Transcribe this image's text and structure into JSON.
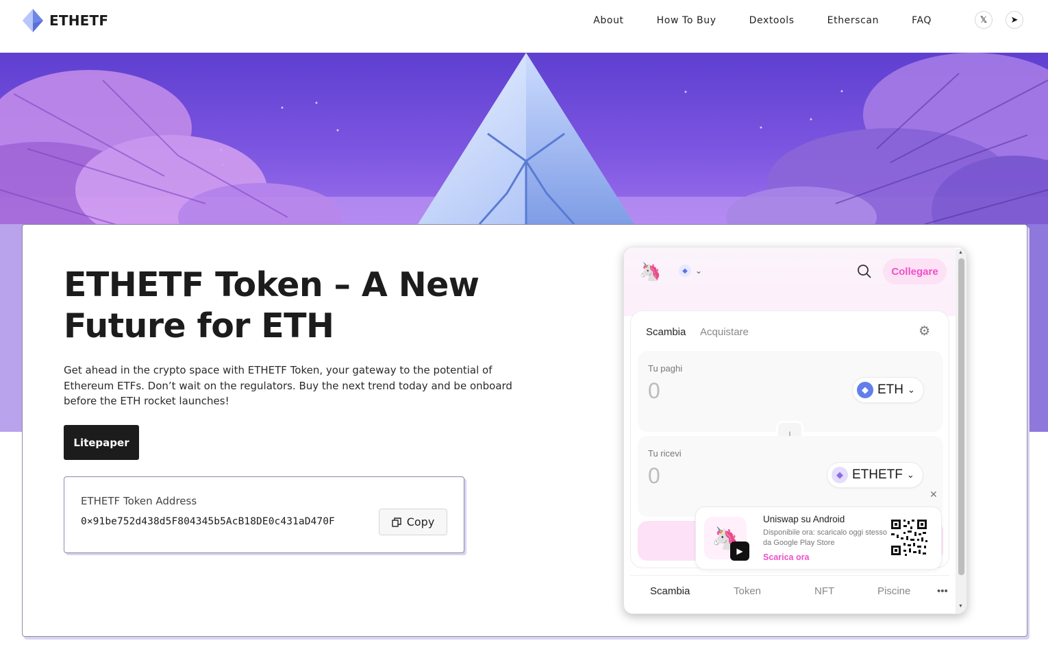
{
  "nav": {
    "brand": "ETHETF",
    "links": [
      "About",
      "How To Buy",
      "Dextools",
      "Etherscan",
      "FAQ"
    ],
    "social_x": "𝕏",
    "social_tg": "➤"
  },
  "hero": {
    "title": "ETHETF Token – A New Future for ETH",
    "description": "Get ahead in the crypto space with ETHETF Token, your gateway to the potential of Ethereum ETFs. Don’t wait on the regulators. Buy the next trend today and be onboard before the ETH rocket launches!",
    "litepaper_label": "Litepaper",
    "address_label": "ETHETF Token Address",
    "address_value": "0×91be752d438d5F804345b5AcB18DE0c431aD470F",
    "copy_label": "Copy"
  },
  "widget": {
    "connect_label": "Collegare",
    "tabs": {
      "swap": "Scambia",
      "buy": "Acquistare"
    },
    "pay": {
      "label": "Tu paghi",
      "amount": "0",
      "token": "ETH"
    },
    "receive": {
      "label": "Tu ricevi",
      "amount": "0",
      "token": "ETHETF"
    },
    "promo": {
      "title": "Uniswap su Android",
      "description": "Disponibile ora: scaricalo oggi stesso da Google Play Store",
      "link": "Scarica ora"
    },
    "bottom_tabs": [
      "Scambia",
      "Token",
      "NFT",
      "Piscine"
    ],
    "more": "•••"
  },
  "colors": {
    "accent_pink": "#f04fc8",
    "banner_purple": "#7b55e0",
    "button_dark": "#1c1c1c"
  }
}
